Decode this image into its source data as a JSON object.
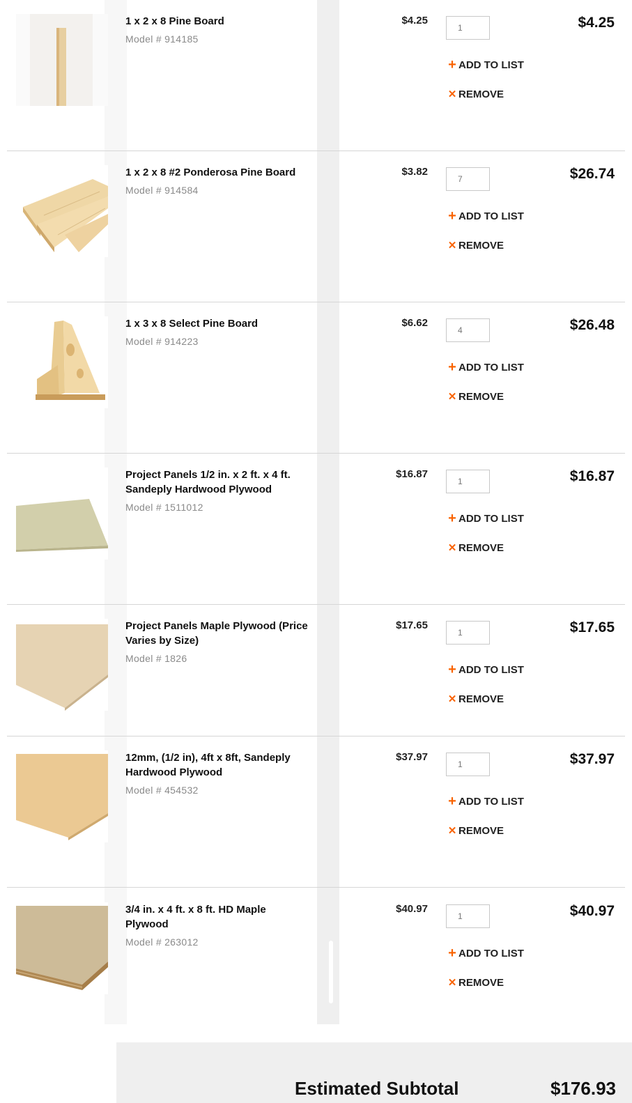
{
  "cart": {
    "items": [
      {
        "name": "1 x 2 x 8 Pine Board",
        "model": "Model # 914185",
        "unit_price": "$4.25",
        "qty": "1",
        "total": "$4.25",
        "add_label": "ADD TO LIST",
        "remove_label": "REMOVE",
        "image": "vertical-pine-board"
      },
      {
        "name": "1 x 2 x 8 #2 Ponderosa Pine Board",
        "model": "Model # 914584",
        "unit_price": "$3.82",
        "qty": "7",
        "total": "$26.74",
        "add_label": "ADD TO LIST",
        "remove_label": "REMOVE",
        "image": "stacked-pine-boards"
      },
      {
        "name": "1 x 3 x 8 Select Pine Board",
        "model": "Model # 914223",
        "unit_price": "$6.62",
        "qty": "4",
        "total": "$26.48",
        "add_label": "ADD TO LIST",
        "remove_label": "REMOVE",
        "image": "leaning-pine-boards"
      },
      {
        "name": "Project Panels  1/2 in. x 2 ft. x 4 ft. Sandeply Hardwood Plywood",
        "model": "Model # 1511012",
        "unit_price": "$16.87",
        "qty": "1",
        "total": "$16.87",
        "add_label": "ADD TO LIST",
        "remove_label": "REMOVE",
        "image": "plywood-panel-thin"
      },
      {
        "name": "Project Panels  Maple Plywood (Price Varies by Size)",
        "model": "Model # 1826",
        "unit_price": "$17.65",
        "qty": "1",
        "total": "$17.65",
        "add_label": "ADD TO LIST",
        "remove_label": "REMOVE",
        "image": "maple-plywood-panel"
      },
      {
        "name": "12mm, (1/2 in), 4ft x 8ft, Sandeply Hardwood Plywood",
        "model": "Model # 454532",
        "unit_price": "$37.97",
        "qty": "1",
        "total": "$37.97",
        "add_label": "ADD TO LIST",
        "remove_label": "REMOVE",
        "image": "sandeply-plywood-sheet"
      },
      {
        "name": "3/4 in. x 4 ft. x 8 ft. HD Maple Plywood",
        "model": "Model # 263012",
        "unit_price": "$40.97",
        "qty": "1",
        "total": "$40.97",
        "add_label": "ADD TO LIST",
        "remove_label": "REMOVE",
        "image": "hd-maple-plywood-sheet"
      }
    ]
  },
  "summary": {
    "label": "Estimated Subtotal",
    "value": "$176.93"
  },
  "colors": {
    "accent": "#f96302",
    "divider": "#d6d6d6",
    "subtotal_bg": "#efefef"
  },
  "icons": {
    "add": "plus-icon",
    "remove": "x-icon"
  }
}
